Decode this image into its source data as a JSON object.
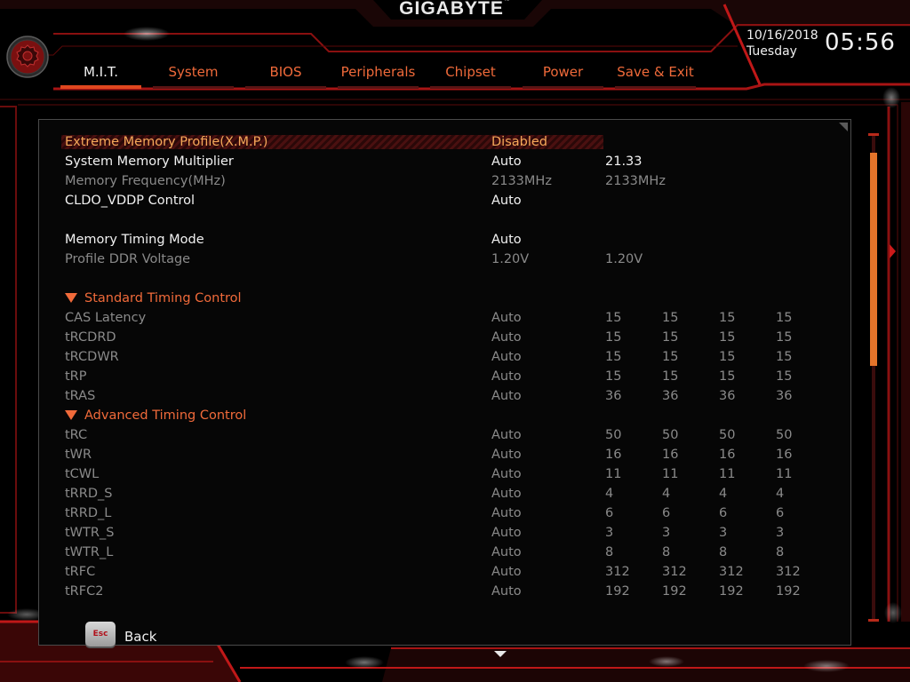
{
  "header": {
    "brand": "GIGABYTE",
    "trademark": "™",
    "date": "10/16/2018",
    "weekday": "Tuesday",
    "time": "05:56"
  },
  "tabs": [
    {
      "label": "M.I.T.",
      "active": true
    },
    {
      "label": "System",
      "active": false
    },
    {
      "label": "BIOS",
      "active": false
    },
    {
      "label": "Peripherals",
      "active": false
    },
    {
      "label": "Chipset",
      "active": false
    },
    {
      "label": "Power",
      "active": false
    },
    {
      "label": "Save & Exit",
      "active": false
    }
  ],
  "settings": [
    {
      "label": "Extreme Memory Profile(X.M.P.)",
      "value": "Disabled",
      "style": "highlight",
      "ch": []
    },
    {
      "label": "System Memory Multiplier",
      "value": "Auto",
      "style": "normal",
      "ch": [
        "21.33"
      ]
    },
    {
      "label": "Memory Frequency(MHz)",
      "value": "2133MHz",
      "style": "dim",
      "ch": [
        "2133MHz"
      ]
    },
    {
      "label": "CLDO_VDDP Control",
      "value": "Auto",
      "style": "normal",
      "ch": []
    },
    {
      "label": "",
      "value": "",
      "style": "spacer",
      "ch": []
    },
    {
      "label": "Memory Timing Mode",
      "value": "Auto",
      "style": "normal",
      "ch": []
    },
    {
      "label": "Profile DDR Voltage",
      "value": "1.20V",
      "style": "dim",
      "ch": [
        "1.20V"
      ]
    },
    {
      "label": "",
      "value": "",
      "style": "spacer",
      "ch": []
    },
    {
      "label": "Standard Timing Control",
      "value": "",
      "style": "header",
      "ch": []
    },
    {
      "label": "CAS Latency",
      "value": "Auto",
      "style": "dim",
      "ch": [
        "15",
        "15",
        "15",
        "15"
      ]
    },
    {
      "label": "tRCDRD",
      "value": "Auto",
      "style": "dim",
      "ch": [
        "15",
        "15",
        "15",
        "15"
      ]
    },
    {
      "label": "tRCDWR",
      "value": "Auto",
      "style": "dim",
      "ch": [
        "15",
        "15",
        "15",
        "15"
      ]
    },
    {
      "label": "tRP",
      "value": "Auto",
      "style": "dim",
      "ch": [
        "15",
        "15",
        "15",
        "15"
      ]
    },
    {
      "label": "tRAS",
      "value": "Auto",
      "style": "dim",
      "ch": [
        "36",
        "36",
        "36",
        "36"
      ]
    },
    {
      "label": "Advanced Timing Control",
      "value": "",
      "style": "header",
      "ch": []
    },
    {
      "label": "tRC",
      "value": "Auto",
      "style": "dim",
      "ch": [
        "50",
        "50",
        "50",
        "50"
      ]
    },
    {
      "label": "tWR",
      "value": "Auto",
      "style": "dim",
      "ch": [
        "16",
        "16",
        "16",
        "16"
      ]
    },
    {
      "label": "tCWL",
      "value": "Auto",
      "style": "dim",
      "ch": [
        "11",
        "11",
        "11",
        "11"
      ]
    },
    {
      "label": "tRRD_S",
      "value": "Auto",
      "style": "dim",
      "ch": [
        "4",
        "4",
        "4",
        "4"
      ]
    },
    {
      "label": "tRRD_L",
      "value": "Auto",
      "style": "dim",
      "ch": [
        "6",
        "6",
        "6",
        "6"
      ]
    },
    {
      "label": "tWTR_S",
      "value": "Auto",
      "style": "dim",
      "ch": [
        "3",
        "3",
        "3",
        "3"
      ]
    },
    {
      "label": "tWTR_L",
      "value": "Auto",
      "style": "dim",
      "ch": [
        "8",
        "8",
        "8",
        "8"
      ]
    },
    {
      "label": "tRFC",
      "value": "Auto",
      "style": "dim",
      "ch": [
        "312",
        "312",
        "312",
        "312"
      ]
    },
    {
      "label": "tRFC2",
      "value": "Auto",
      "style": "dim",
      "ch": [
        "192",
        "192",
        "192",
        "192"
      ]
    }
  ],
  "footer": {
    "esc_key": "Esc",
    "back_label": "Back"
  },
  "colors": {
    "accent": "#e0471f",
    "highlight_text": "#f5a85a",
    "section_header": "#f06a3a",
    "frame_red": "#b01515"
  }
}
